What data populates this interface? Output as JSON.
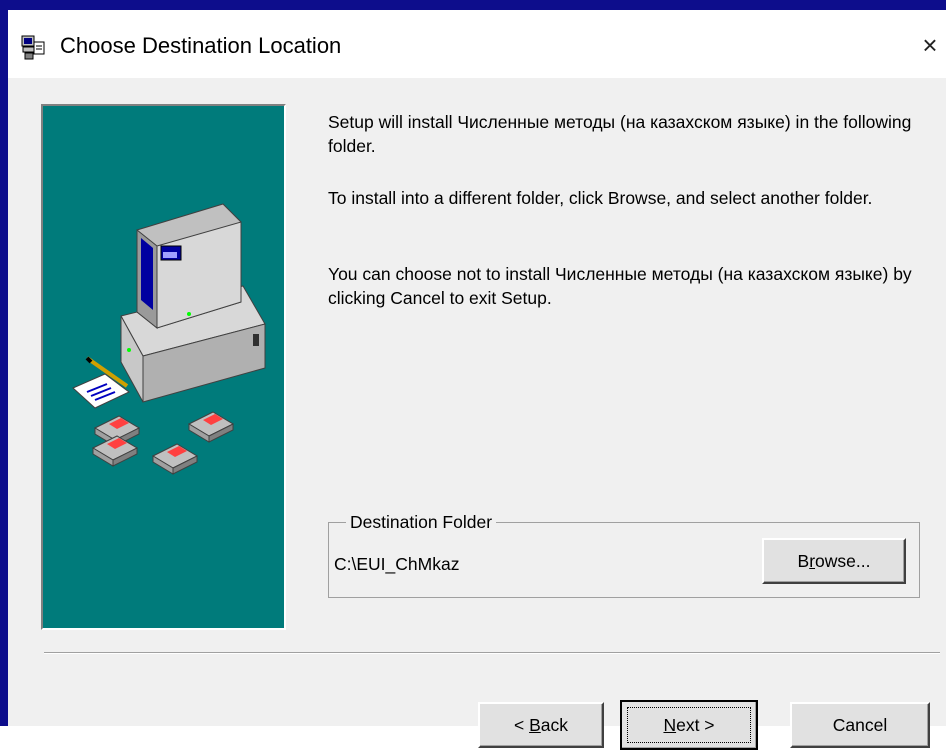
{
  "window": {
    "title": "Choose Destination Location",
    "icon": "installer-icon",
    "close_icon": "close-icon",
    "close_glyph": "×"
  },
  "body": {
    "paragraph1": "Setup will install Численные методы (на казахском языке) in the following folder.",
    "paragraph2": "To install into a different folder, click Browse, and select another folder.",
    "paragraph3": "You can choose not to install Численные методы (на казахском языке) by clicking Cancel to exit Setup."
  },
  "destination": {
    "group_label": "Destination Folder",
    "path": "C:\\EUI_ChMkaz",
    "browse_label_prefix": "B",
    "browse_label_accel": "r",
    "browse_label_suffix": "owse..."
  },
  "buttons": {
    "back_prefix": "< ",
    "back_accel": "B",
    "back_suffix": "ack",
    "next_accel": "N",
    "next_suffix": "ext >",
    "cancel_label": "Cancel"
  },
  "colors": {
    "title_bar_accent": "#0d0d8c",
    "panel_background": "#007b7b",
    "dialog_background": "#f0f0f0"
  }
}
